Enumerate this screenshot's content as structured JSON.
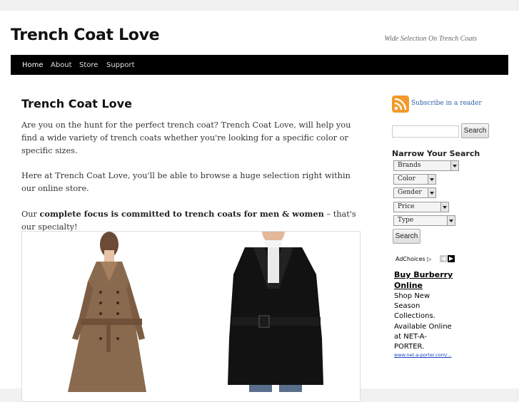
{
  "header": {
    "site_title": "Trench Coat Love",
    "tagline": "Wide Selection On Trench Coats"
  },
  "nav": {
    "items": [
      {
        "label": "Home",
        "active": true
      },
      {
        "label": "About"
      },
      {
        "label": "Store"
      },
      {
        "label": "Support"
      }
    ]
  },
  "post": {
    "title": "Trench Coat Love",
    "para1": "Are you on the hunt for the perfect trench coat? Trench Coat Love, will help you find a wide variety of trench coats whether you're looking for a specific color or specific sizes.",
    "para2": "Here at Trench Coat Love, you'll be able to browse a huge selection right within our online store.",
    "para3_prefix": "Our ",
    "para3_bold": "complete focus is committed to trench coats for men & women",
    "para3_suffix": " – that's our specialty!"
  },
  "sidebar": {
    "rss_label": "Subscribe in a reader",
    "search_button": "Search",
    "search_value": "",
    "narrow_title": "Narrow Your Search",
    "selects": [
      "Brands",
      "Color",
      "Gender",
      "Price",
      "Type"
    ],
    "narrow_button": "Search"
  },
  "ad": {
    "adchoices_label": "AdChoices",
    "title": "Buy Burberry Online",
    "body": "Shop New Season Collections. Available Online at NET-A-PORTER.",
    "url": "www.net-a-porter.com/..."
  },
  "colors": {
    "nav_bg": "#000000",
    "link": "#2b5ca8",
    "rss": "#f39a2b"
  }
}
